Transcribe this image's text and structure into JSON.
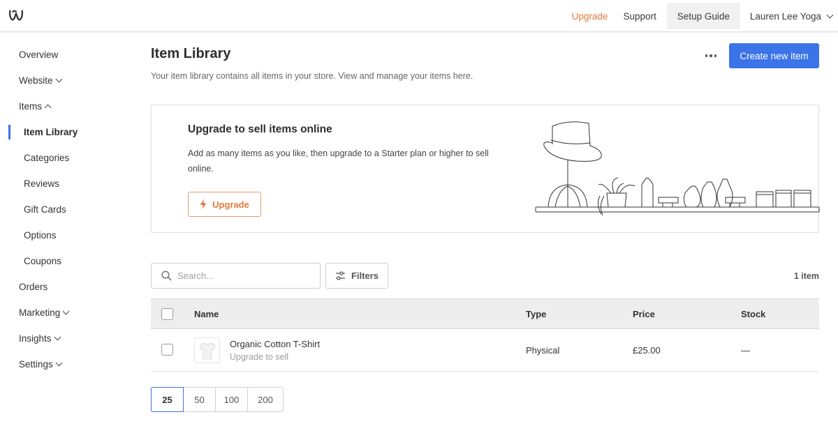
{
  "header": {
    "logo_icon": "weebly-w-icon",
    "upgrade_label": "Upgrade",
    "support_label": "Support",
    "setup_guide_label": "Setup Guide",
    "account_label": "Lauren Lee Yoga"
  },
  "sidebar": {
    "items": [
      {
        "label": "Overview"
      },
      {
        "label": "Website"
      },
      {
        "label": "Items"
      },
      {
        "label": "Item Library"
      },
      {
        "label": "Categories"
      },
      {
        "label": "Reviews"
      },
      {
        "label": "Gift Cards"
      },
      {
        "label": "Options"
      },
      {
        "label": "Coupons"
      },
      {
        "label": "Orders"
      },
      {
        "label": "Marketing"
      },
      {
        "label": "Insights"
      },
      {
        "label": "Settings"
      }
    ]
  },
  "main": {
    "title": "Item Library",
    "description": "Your item library contains all items in your store. View and manage your items here.",
    "create_button_label": "Create new item",
    "promo": {
      "title": "Upgrade to sell items online",
      "text": "Add as many items as you like, then upgrade to a Starter plan or higher to sell online.",
      "button_label": "Upgrade"
    },
    "search": {
      "placeholder": "Search..."
    },
    "filters_label": "Filters",
    "item_count": "1 item",
    "table": {
      "headers": {
        "name": "Name",
        "type": "Type",
        "price": "Price",
        "stock": "Stock"
      },
      "rows": [
        {
          "name": "Organic Cotton T-Shirt",
          "status": "Upgrade to sell",
          "type": "Physical",
          "price": "£25.00",
          "stock": "—"
        }
      ]
    },
    "pagination": {
      "sizes": [
        "25",
        "50",
        "100",
        "200"
      ],
      "selected": "25"
    }
  },
  "colors": {
    "accent": "#3b73e8",
    "upgrade": "#e07a3c"
  }
}
